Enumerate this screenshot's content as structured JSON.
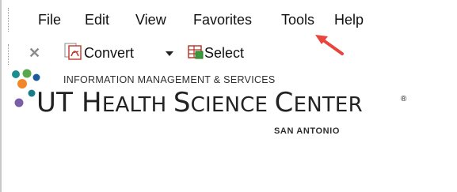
{
  "menubar": {
    "items": [
      {
        "label": "File"
      },
      {
        "label": "Edit"
      },
      {
        "label": "View"
      },
      {
        "label": "Favorites"
      },
      {
        "label": "Tools"
      },
      {
        "label": "Help"
      }
    ]
  },
  "toolbar": {
    "close_icon": "close-icon",
    "convert_label": "Convert",
    "select_label": "Select"
  },
  "logo": {
    "subtitle": "INFORMATION MANAGEMENT & SERVICES",
    "title_big1": "UT H",
    "title_small1": "EALTH ",
    "title_big2": "S",
    "title_small2": "CIENCE ",
    "title_big3": "C",
    "title_small3": "ENTER",
    "registered": "®",
    "location": "SAN ANTONIO",
    "colors": {
      "teal": "#1a8f8f",
      "blue": "#1c5a9e",
      "orange": "#f2872a",
      "green": "#56a84a",
      "purple": "#7b5ea8",
      "teal_dark": "#1d7a8a"
    }
  },
  "annotation": {
    "arrow_color": "#e8453c"
  }
}
